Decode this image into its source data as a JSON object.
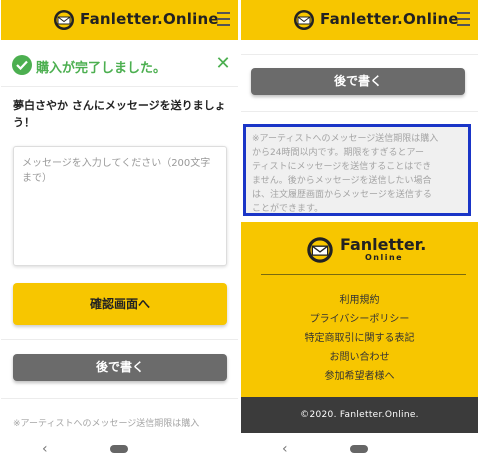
{
  "header": {
    "logo_text": "Fanletter.Online"
  },
  "left": {
    "success_message": "購入が完了しました。",
    "invite_line1": "夢白さやか さんにメッセージを送りましょ",
    "invite_line2": "う！",
    "textarea_placeholder_line1": "メッセージを入力してください（200文字",
    "textarea_placeholder_line2": "まで）",
    "confirm_button": "確認画面へ",
    "later_button": "後で書く",
    "notice_partial": "※アーティストへのメッセージ送信期限は購入"
  },
  "right": {
    "later_button": "後で書く",
    "notice_lines": [
      "※アーティストへのメッセージ送信期限は購入",
      "から24時間以内です。期限をすぎるとアー",
      "ティストにメッセージを送信することはでき",
      "ません。後からメッセージを送信したい場合",
      "は、注文履歴画面からメッセージを送信する",
      "ことができます。"
    ],
    "footer_logo_text": "Fanletter.",
    "footer_logo_sub": "Online",
    "footer_links": [
      "利用規約",
      "プライバシーポリシー",
      "特定商取引に関する表記",
      "お問い合わせ",
      "参加希望者様へ"
    ],
    "copyright": "©2020. Fanletter.Online."
  },
  "colors": {
    "brand_yellow": "#f7c600",
    "success_green": "#4caf50",
    "button_gray": "#6b6b6b",
    "highlight_blue": "#1a35c7",
    "footer_dark": "#3b3b3b"
  },
  "icons": [
    "fanletter-logo-icon",
    "hamburger-menu-icon",
    "check-circle-icon",
    "close-icon",
    "back-nav-icon",
    "home-nav-icon"
  ]
}
